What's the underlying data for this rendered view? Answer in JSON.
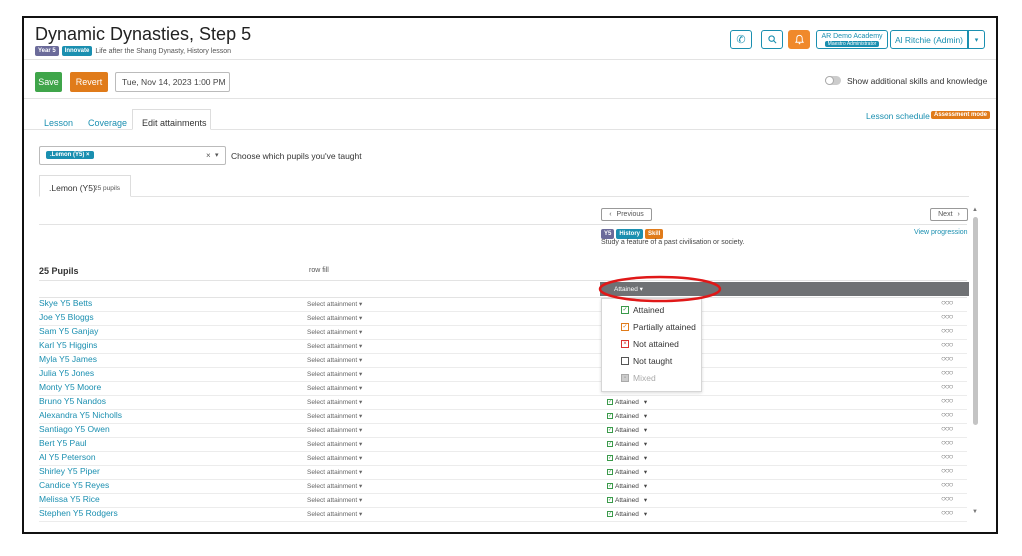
{
  "header": {
    "title": "Dynamic Dynasties, Step 5",
    "tag_year": "Year 5",
    "tag_innovate": "Innovate",
    "lesson_subtitle": "Life after the Shang Dynasty, History lesson",
    "academy": "AR Demo Academy",
    "role_badge": "Maestro Administrator",
    "user": "Al Ritchie (Admin)"
  },
  "toolbar": {
    "save_label": "Save",
    "revert_label": "Revert",
    "date_value": "Tue, Nov 14, 2023 1:00 PM",
    "toggle_label": "Show additional skills and knowledge"
  },
  "tabs": [
    {
      "label": "Lesson"
    },
    {
      "label": "Coverage"
    },
    {
      "label": "Edit attainments"
    }
  ],
  "lesson_schedule": "Lesson schedule",
  "assessment_mode": "Assessment mode",
  "class_selector": {
    "chip": ".Lemon (Y5)",
    "chip_close": "×",
    "clear": "×",
    "caret": "▾",
    "hint": "Choose which pupils you've taught"
  },
  "class_tab": {
    "name": ".Lemon (Y5)",
    "count": "25 pupils"
  },
  "progression": {
    "previous_label": "Previous",
    "next_label": "Next",
    "tag_y5": "Y5",
    "tag_history": "History",
    "tag_skill": "Skill",
    "objective": "Study a feature of a past civilisation or society.",
    "view_label": "View progression"
  },
  "table": {
    "pupils_heading": "25 Pupils",
    "row_fill_label": "row fill",
    "fill_value": "Attained",
    "select_placeholder": "Select attainment",
    "attained_label": "Attained"
  },
  "dropdown": {
    "items": [
      {
        "label": "Attained",
        "mark": "✓",
        "color": "#3a9a4a"
      },
      {
        "label": "Partially attained",
        "mark": "✓",
        "color": "#e07b1a"
      },
      {
        "label": "Not attained",
        "mark": "×",
        "color": "#d93030"
      },
      {
        "label": "Not taught",
        "mark": "",
        "color": "#555555"
      },
      {
        "label": "Mixed",
        "mark": "▪",
        "color": "#aaaaaa"
      }
    ]
  },
  "pupils": [
    {
      "name": "Skye Y5 Betts"
    },
    {
      "name": "Joe Y5 Bloggs"
    },
    {
      "name": "Sam Y5 Ganjay"
    },
    {
      "name": "Karl Y5 Higgins"
    },
    {
      "name": "Myla Y5 James"
    },
    {
      "name": "Julia Y5 Jones"
    },
    {
      "name": "Monty Y5 Moore"
    },
    {
      "name": "Bruno Y5 Nandos"
    },
    {
      "name": "Alexandra Y5 Nicholls"
    },
    {
      "name": "Santiago Y5 Owen"
    },
    {
      "name": "Bert Y5 Paul"
    },
    {
      "name": "Al Y5 Peterson"
    },
    {
      "name": "Shirley Y5 Piper"
    },
    {
      "name": "Candice Y5 Reyes"
    },
    {
      "name": "Melissa Y5 Rice"
    },
    {
      "name": "Stephen Y5 Rodgers"
    }
  ],
  "colors": {
    "accent": "#1a8fb0",
    "save": "#3fa54a",
    "revert": "#e07b1a",
    "bell": "#f0892b",
    "highlight_ring": "#e01818"
  }
}
